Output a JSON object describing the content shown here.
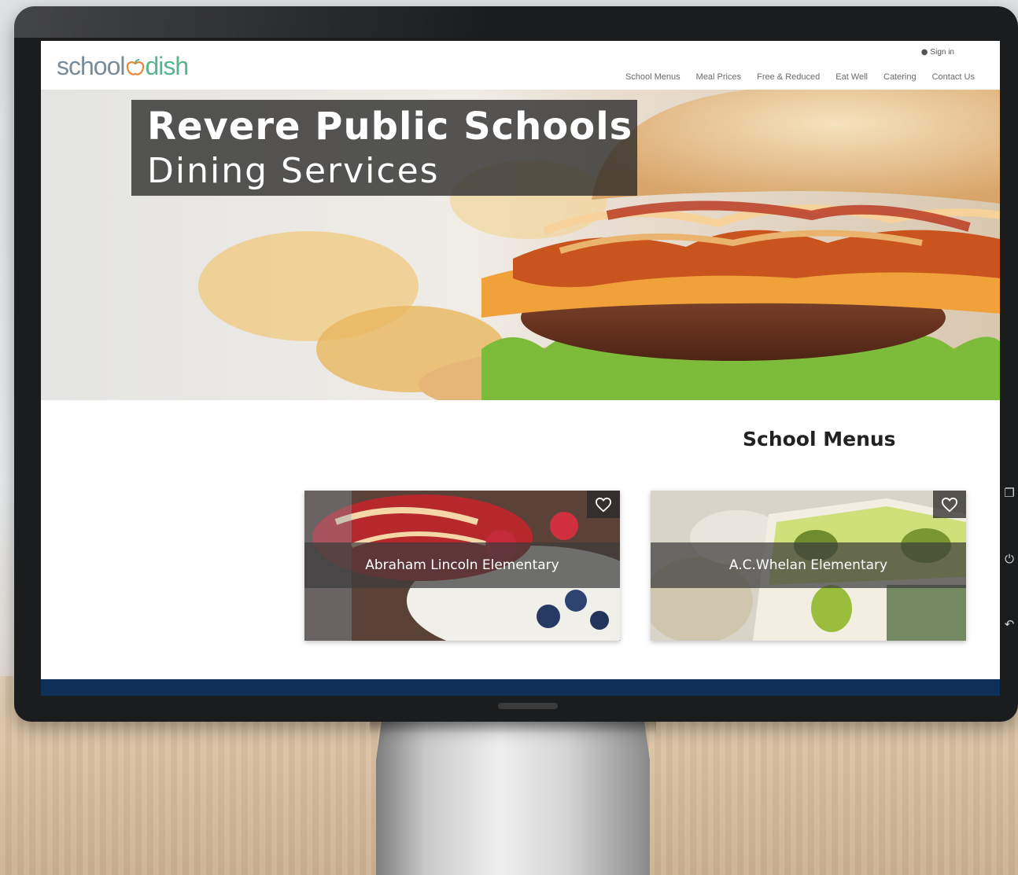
{
  "site": {
    "logo_left": "school",
    "logo_right": "dish",
    "signin_label": "Sign in"
  },
  "nav": {
    "items": [
      "School Menus",
      "Meal Prices",
      "Free & Reduced",
      "Eat Well",
      "Catering",
      "Contact Us"
    ]
  },
  "hero": {
    "title_line1": "Revere Public Schools",
    "title_line2": "Dining Services"
  },
  "menus": {
    "heading": "School Menus",
    "cards": [
      {
        "label": "Abraham Lincoln Elementary"
      },
      {
        "label": "A.C.Whelan Elementary"
      }
    ]
  },
  "colors": {
    "logo_gray": "#7a8b99",
    "logo_green": "#55b58b",
    "footer_navy": "#0e2f57"
  },
  "icons": {
    "signin": "user-circle-icon",
    "favorite": "heart-outline-icon",
    "monitor_buttons": [
      "window-icon",
      "power-icon",
      "back-icon"
    ]
  }
}
